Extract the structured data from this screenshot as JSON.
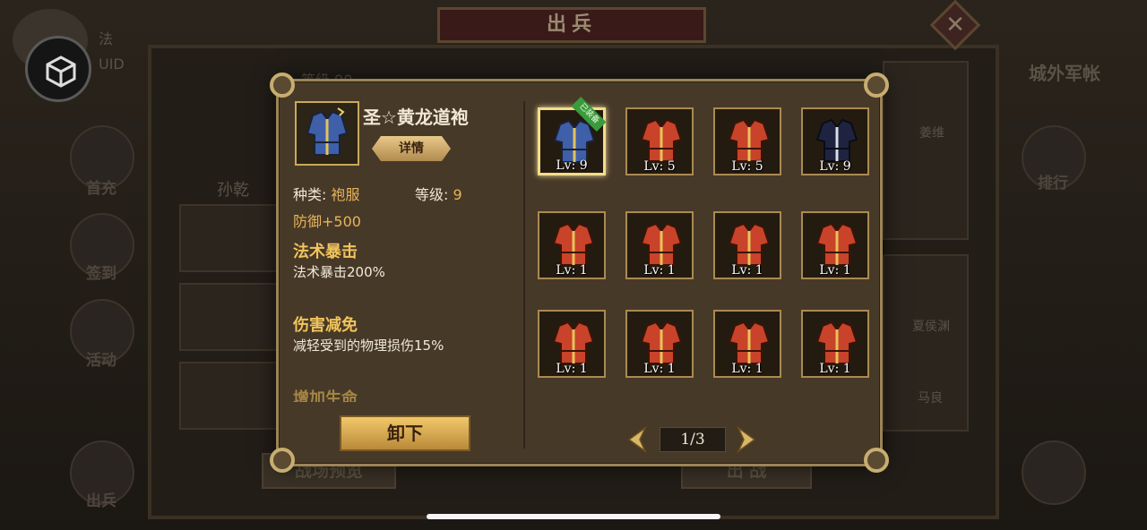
{
  "background": {
    "title": "出兵",
    "close_icon": "close-icon",
    "uid_label": "UID",
    "char_prefix": "法",
    "right_tab": "城外军帐",
    "side_menu": [
      {
        "label": "首充",
        "icon": "first-charge-icon"
      },
      {
        "label": "签到",
        "icon": "sign-in-icon"
      },
      {
        "label": "活动",
        "icon": "activity-icon"
      },
      {
        "label": "出兵",
        "icon": "dispatch-icon"
      }
    ],
    "rank_label": "排行",
    "level_label": "等级 90",
    "hero_name_text": "孙乾",
    "battle_preview": "战场预览",
    "dispatch_btn": "出 战",
    "heroes": [
      "姜维",
      "夏侯渊",
      "马良"
    ]
  },
  "modal": {
    "item": {
      "name": "圣☆黄龙道袍",
      "detail_label": "详情",
      "type_label": "种类:",
      "type_value": "袍服",
      "level_label": "等级:",
      "level_value": "9",
      "defense": "防御+500",
      "skills": [
        {
          "title": "法术暴击",
          "desc": "法术暴击200%"
        },
        {
          "title": "伤害减免",
          "desc": "减轻受到的物理损伤15%"
        },
        {
          "title": "增加生命",
          "desc": ""
        }
      ],
      "unload_label": "卸下"
    },
    "equipped_badge": "已装备",
    "slots": [
      {
        "lv": "Lv: 9",
        "kind": "blue-robe",
        "selected": true
      },
      {
        "lv": "Lv: 5",
        "kind": "red-robe"
      },
      {
        "lv": "Lv: 5",
        "kind": "red-robe"
      },
      {
        "lv": "Lv: 9",
        "kind": "black-robe"
      },
      {
        "lv": "Lv: 1",
        "kind": "red-robe"
      },
      {
        "lv": "Lv: 1",
        "kind": "red-robe"
      },
      {
        "lv": "Lv: 1",
        "kind": "red-robe"
      },
      {
        "lv": "Lv: 1",
        "kind": "red-robe"
      },
      {
        "lv": "Lv: 1",
        "kind": "red-robe"
      },
      {
        "lv": "Lv: 1",
        "kind": "red-robe"
      },
      {
        "lv": "Lv: 1",
        "kind": "red-robe"
      },
      {
        "lv": "Lv: 1",
        "kind": "red-robe"
      }
    ],
    "pager": {
      "text": "1/3",
      "prev_icon": "chevron-left-icon",
      "next_icon": "chevron-right-icon"
    }
  },
  "colors": {
    "gold": "#c9a95c",
    "panel": "#473928",
    "accent_text": "#e7b45a"
  }
}
